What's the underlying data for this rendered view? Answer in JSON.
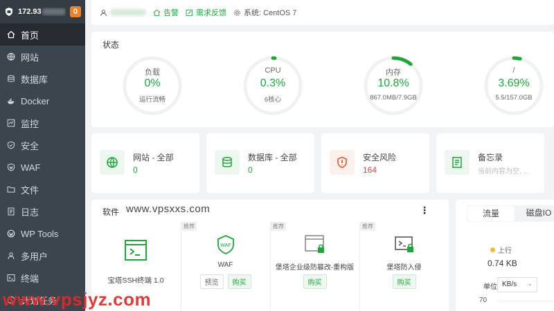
{
  "sidebar": {
    "ip": "172.93",
    "badge": "0",
    "items": [
      {
        "label": "首页",
        "icon": "home-icon"
      },
      {
        "label": "网站",
        "icon": "globe-icon"
      },
      {
        "label": "数据库",
        "icon": "database-icon"
      },
      {
        "label": "Docker",
        "icon": "docker-icon"
      },
      {
        "label": "监控",
        "icon": "monitor-icon"
      },
      {
        "label": "安全",
        "icon": "shield-icon"
      },
      {
        "label": "WAF",
        "icon": "waf-icon"
      },
      {
        "label": "文件",
        "icon": "folder-icon"
      },
      {
        "label": "日志",
        "icon": "log-icon"
      },
      {
        "label": "WP Tools",
        "icon": "wordpress-icon"
      },
      {
        "label": "多用户",
        "icon": "users-icon"
      },
      {
        "label": "终端",
        "icon": "terminal-icon"
      },
      {
        "label": "计划任务",
        "icon": "clock-icon"
      }
    ]
  },
  "topbar": {
    "alert": "告警",
    "feedback": "需求反馈",
    "system": "系统: CentOS 7"
  },
  "status": {
    "title": "状态",
    "gauges": [
      {
        "label": "负载",
        "value": "0%",
        "sub": "运行流畅",
        "fraction": 0.0
      },
      {
        "label": "CPU",
        "value": "0.3%",
        "sub": "6核心",
        "fraction": 0.003
      },
      {
        "label": "内存",
        "value": "10.8%",
        "sub": "867.0MB/7.9GB",
        "fraction": 0.108
      },
      {
        "label": "/",
        "value": "3.69%",
        "sub": "5.5/157.0GB",
        "fraction": 0.0369
      }
    ]
  },
  "cards": [
    {
      "title": "网站 - 全部",
      "value": "0"
    },
    {
      "title": "数据库 - 全部",
      "value": "0"
    },
    {
      "title": "安全风险",
      "value": "164"
    },
    {
      "title": "备忘录",
      "value": "当前内容为空, ..."
    }
  ],
  "software": {
    "title": "软件",
    "site": "www.vpsxxs.com",
    "menu": "⋮",
    "items": [
      {
        "name": "宝塔SSH终端 1.0"
      },
      {
        "tag": "推荐",
        "name": "WAF",
        "preview": "预览",
        "buy": "购买"
      },
      {
        "tag": "推荐",
        "name": "堡塔企业级防篡改-重构版",
        "buy": "购买"
      },
      {
        "tag": "推荐",
        "name": "堡塔防入侵",
        "buy": "购买"
      }
    ]
  },
  "traffic": {
    "tab_traffic": "流量",
    "tab_disk": "磁盘IO",
    "up_label": "上行",
    "up_value": "0.74 KB",
    "unit_label": "单位",
    "unit_value": "KB/s",
    "axis_max": "70"
  },
  "watermark": "www.vpsjyz.com",
  "colors": {
    "accent": "#20a53a",
    "danger": "#e04040",
    "sidebar": "#3c444d",
    "badge": "#f0822d"
  }
}
